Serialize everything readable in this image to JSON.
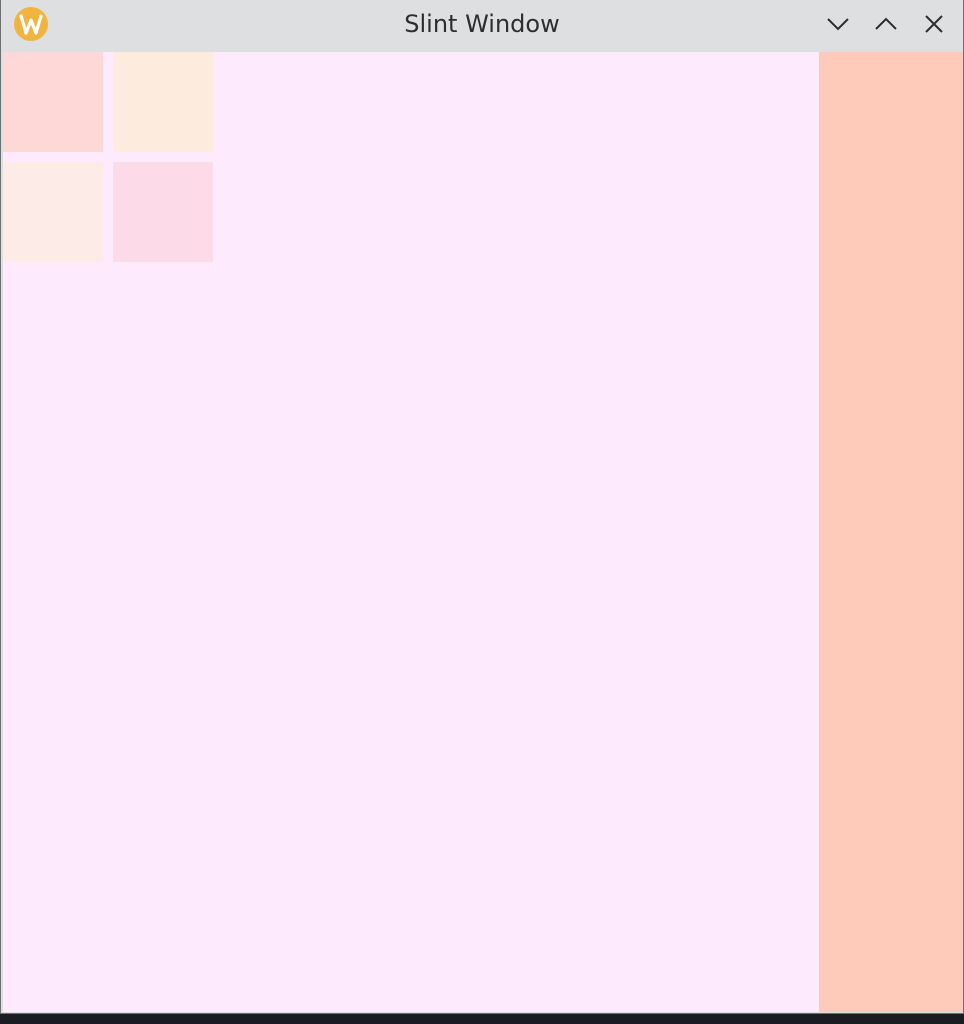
{
  "window": {
    "title": "Slint Window",
    "app_icon": "wayland-w-icon",
    "controls": {
      "minimize_icon": "chevron-down-icon",
      "maximize_icon": "chevron-up-icon",
      "close_icon": "close-icon"
    }
  },
  "colors": {
    "titlebar": "#dedfe1",
    "client_background": "#fdebfd",
    "side_panel": "#fecaba",
    "tiles": [
      "#fed8d7",
      "#fdebdd",
      "#fdebe8",
      "#fddae7"
    ],
    "app_icon": "#f2b441"
  }
}
